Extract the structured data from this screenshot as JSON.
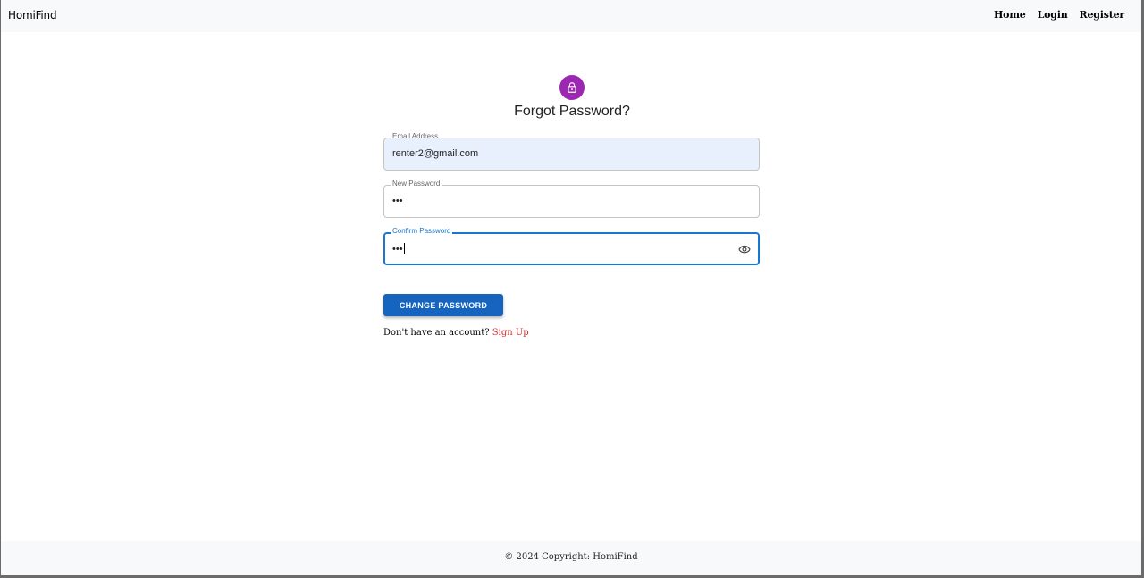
{
  "navbar": {
    "brand": "HomiFind",
    "links": [
      "Home",
      "Login",
      "Register"
    ]
  },
  "form": {
    "icon": "lock-icon",
    "icon_bg_color": "#9c27b0",
    "title": "Forgot Password?",
    "email": {
      "label": "Email Address",
      "value": "renter2@gmail.com"
    },
    "new_password": {
      "label": "New Password",
      "value": "•••"
    },
    "confirm_password": {
      "label": "Confirm Password",
      "value": "•••",
      "toggle_icon": "eye-icon"
    },
    "submit_label": "CHANGE PASSWORD",
    "submit_color": "#1565c0",
    "signup_prompt": "Don't have an account?",
    "signup_link": "Sign Up"
  },
  "footer": {
    "copyright": "© 2024 Copyright: HomiFind"
  }
}
